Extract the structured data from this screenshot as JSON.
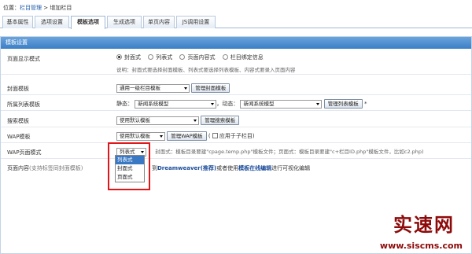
{
  "breadcrumb": {
    "prefix": "位置：",
    "crumb1": "栏目管理",
    "sep": " > ",
    "crumb2": "增加栏目"
  },
  "tabs": [
    {
      "label": "基本属性",
      "active": false
    },
    {
      "label": "选项设置",
      "active": false
    },
    {
      "label": "模板选项",
      "active": true
    },
    {
      "label": "生成选项",
      "active": false
    },
    {
      "label": "单页内容",
      "active": false
    },
    {
      "label": "JS调用设置",
      "active": false
    }
  ],
  "panel": {
    "title": "模板设置"
  },
  "page_mode": {
    "label": "页面显示模式",
    "options": [
      "封面式",
      "列表式",
      "页面内容式",
      "栏目绑定信息"
    ],
    "selected": "封面式",
    "hint": "说明：封面式要选择封面模板、列表式要选择列表模板、内容式要录入页面内容"
  },
  "cover_template": {
    "label": "封面模板",
    "select_value": "通用一级栏目模板",
    "button": "管理封面模板"
  },
  "list_template": {
    "label": "所属列表模板",
    "static_label": "静态：",
    "static_value": "新闻系统模型",
    "dynamic_label": "，动态：",
    "dynamic_value": "新闻系统模型",
    "button": "管理列表模板",
    "required_mark": "*"
  },
  "search_template": {
    "label": "搜索模板",
    "select_value": "使用默认模板",
    "button": "管理搜索模板"
  },
  "wap_template": {
    "label": "WAP模板",
    "select_value": "使用默认模板",
    "button": "管理WAP模板",
    "checkbox_prefix": "(",
    "checkbox_label": "应用于子栏目)"
  },
  "wap_page_mode": {
    "label": "WAP页面模式",
    "select_value": "列表式",
    "hint": "封面式：模板目录要建\"cpage.temp.php\"模板文件；页面式：模板目录要建\"c+栏目ID.php\"模板文件，比如c2.php)",
    "dropdown_options": [
      "列表式",
      "封面式",
      "页面式"
    ],
    "dropdown_selected": "列表式"
  },
  "page_content": {
    "label": "页面内容",
    "label_note": "(支持标签同封面模板)",
    "text_pre": "到",
    "text_bold": "Dreamweaver(推荐)",
    "text_mid": "或者使用",
    "text_link": "模板在线编辑",
    "text_post": "进行可视化编辑"
  },
  "watermark": {
    "title": "实速网",
    "url": "www.siscms.com"
  },
  "colors": {
    "accent": "#3b7fc6",
    "highlight_box": "#e0161b",
    "watermark": "#8d0a0a"
  }
}
